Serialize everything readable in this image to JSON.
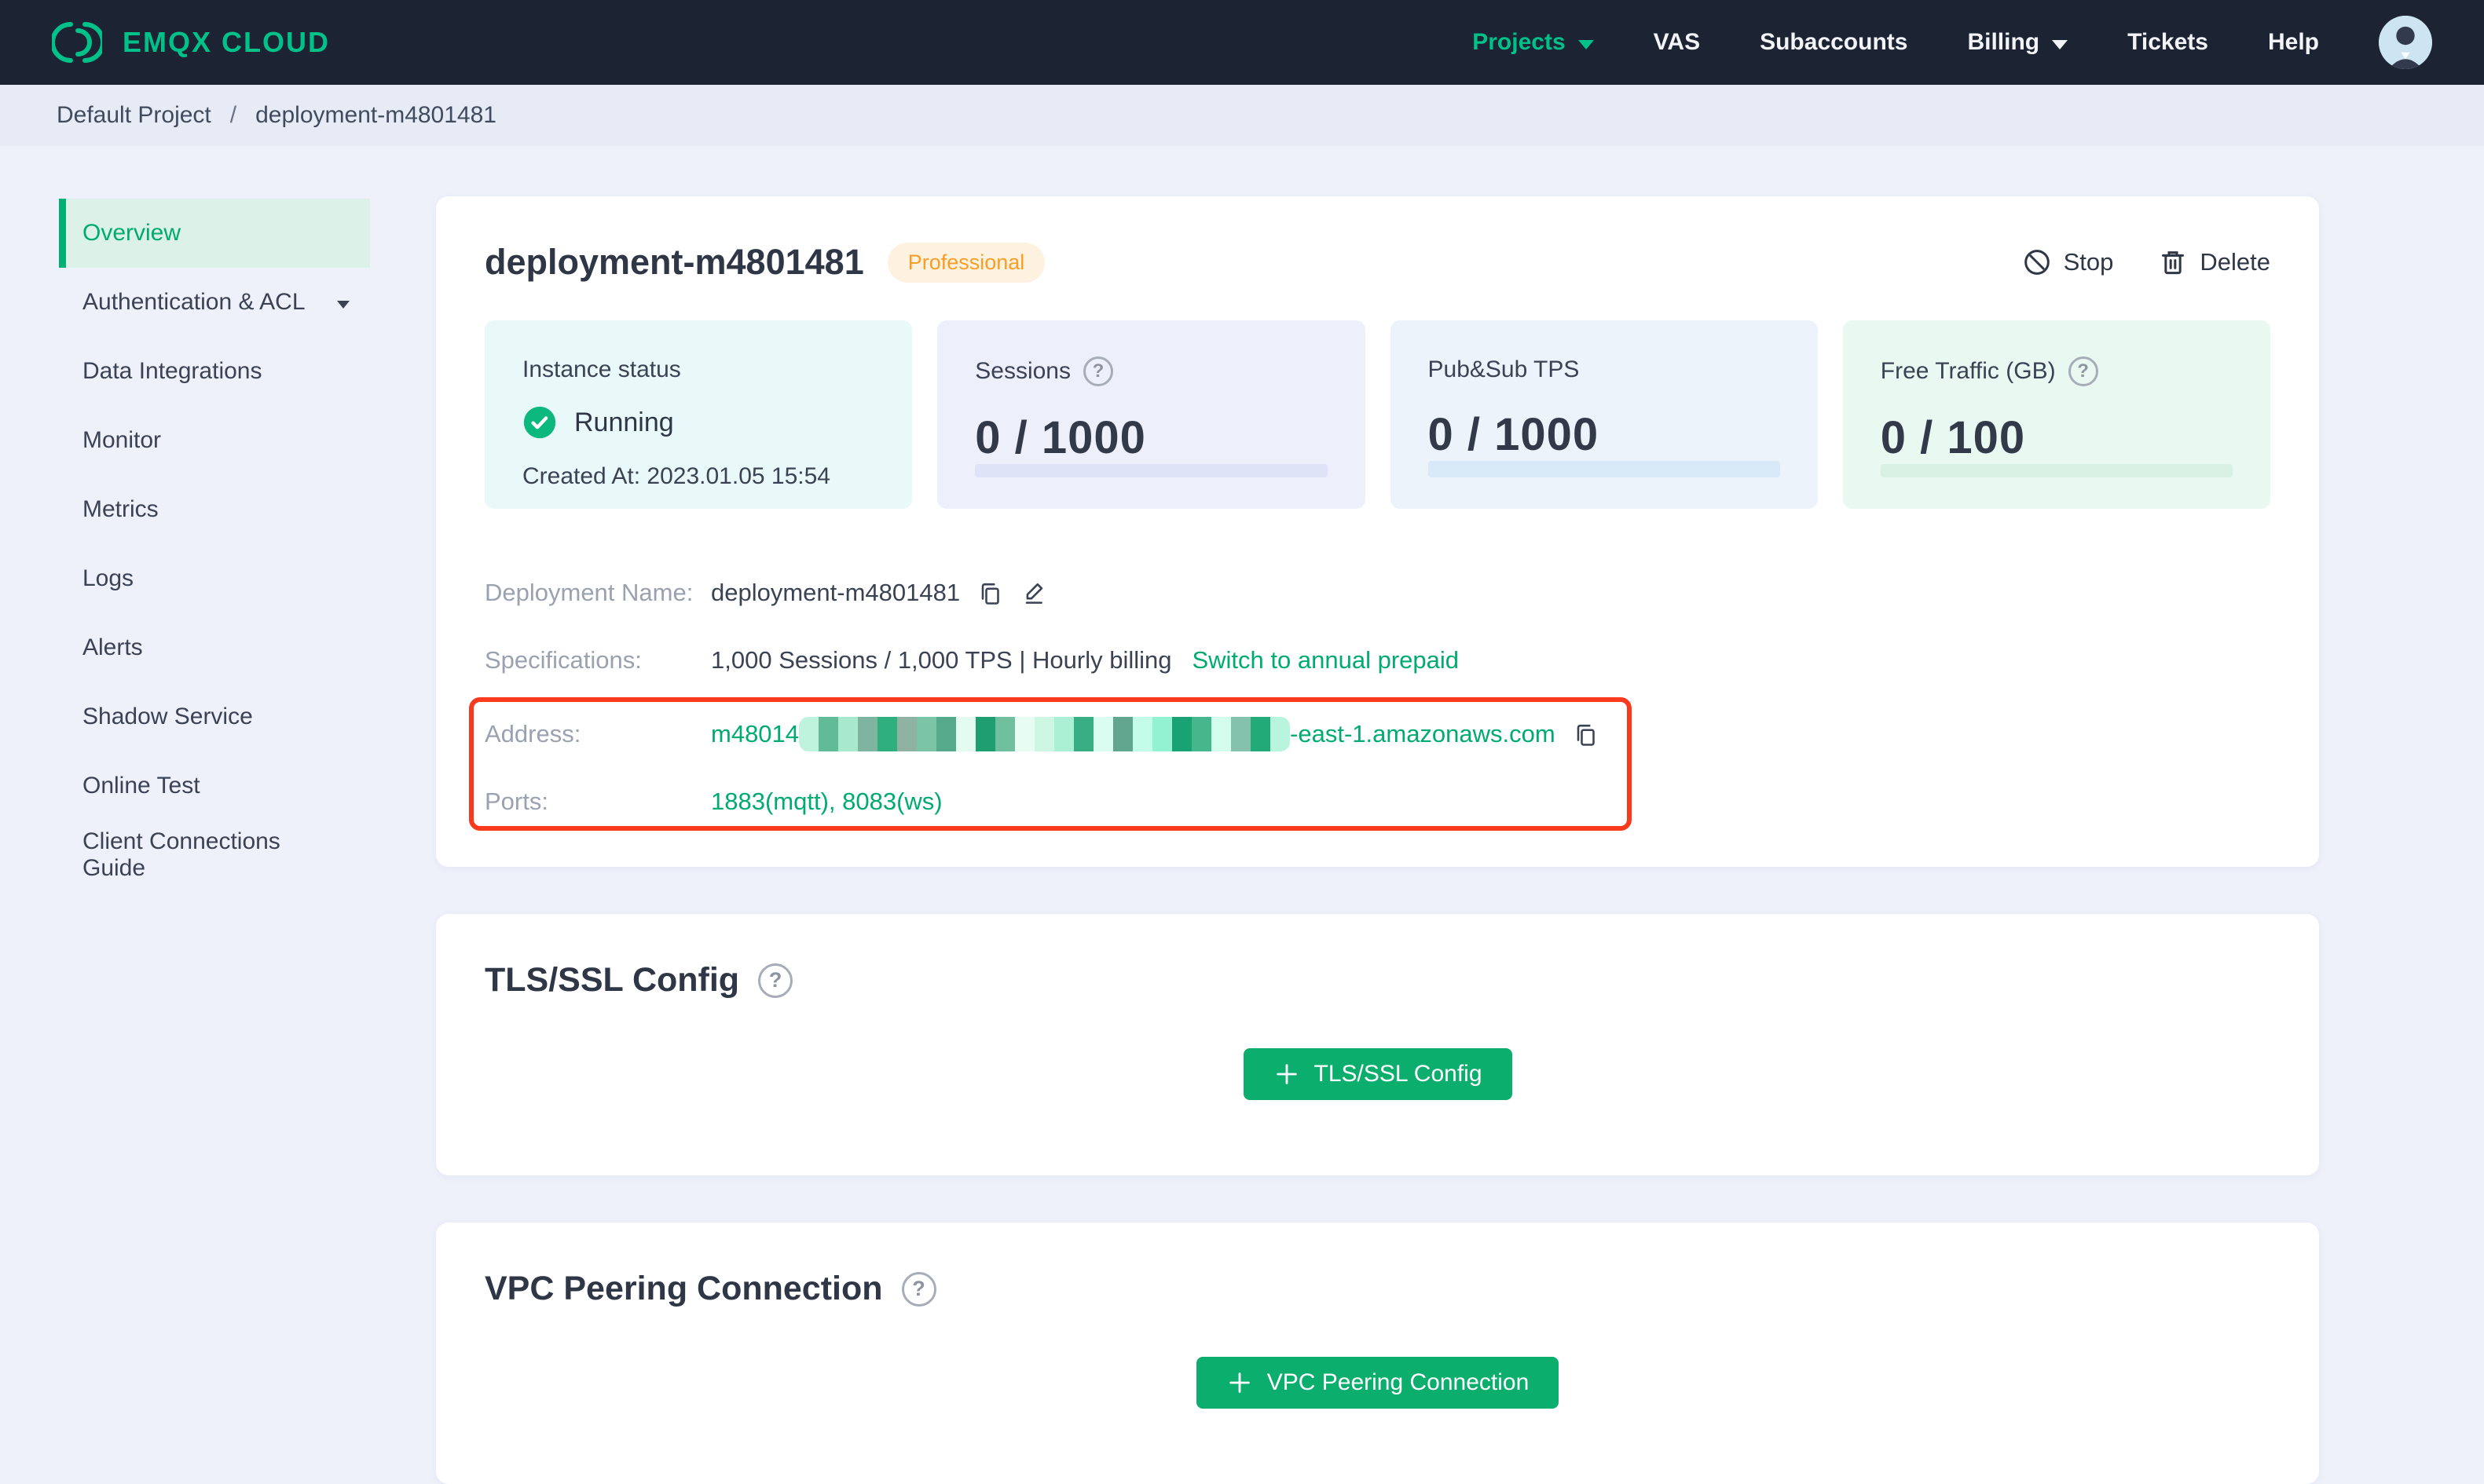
{
  "brand": {
    "name": "EMQX CLOUD",
    "color": "#00c18a"
  },
  "nav": {
    "items": [
      {
        "label": "Projects",
        "active": true,
        "caret": true
      },
      {
        "label": "VAS"
      },
      {
        "label": "Subaccounts"
      },
      {
        "label": "Billing",
        "caret": true
      },
      {
        "label": "Tickets"
      },
      {
        "label": "Help"
      }
    ]
  },
  "breadcrumb": {
    "project": "Default Project",
    "separator": "/",
    "current": "deployment-m4801481"
  },
  "sidebar": {
    "items": [
      {
        "label": "Overview",
        "active": true
      },
      {
        "label": "Authentication & ACL",
        "caret": true
      },
      {
        "label": "Data Integrations"
      },
      {
        "label": "Monitor"
      },
      {
        "label": "Metrics"
      },
      {
        "label": "Logs"
      },
      {
        "label": "Alerts"
      },
      {
        "label": "Shadow Service"
      },
      {
        "label": "Online Test"
      },
      {
        "label": "Client Connections Guide"
      }
    ]
  },
  "overview": {
    "title": "deployment-m4801481",
    "badge": "Professional",
    "stop_label": "Stop",
    "delete_label": "Delete",
    "instance": {
      "label": "Instance status",
      "status": "Running",
      "created": "Created At: 2023.01.05 15:54"
    },
    "stats": [
      {
        "label": "Sessions",
        "value": "0 / 1000",
        "help": true
      },
      {
        "label": "Pub&Sub TPS",
        "value": "0 / 1000",
        "help": false
      },
      {
        "label": "Free Traffic (GB)",
        "value": "0 / 100",
        "help": true
      }
    ],
    "details": {
      "name_label": "Deployment Name:",
      "name_value": "deployment-m4801481",
      "spec_label": "Specifications:",
      "spec_value": "1,000 Sessions / 1,000 TPS | Hourly billing",
      "spec_link": "Switch to annual prepaid",
      "address_label": "Address:",
      "address_prefix": "m48014",
      "address_suffix": "-east-1.amazonaws.com",
      "address_redacted_colors": [
        "#bff3dd",
        "#62bb97",
        "#a8e8cd",
        "#7fb5a0",
        "#2fae7e",
        "#8fb2a3",
        "#7cc4a6",
        "#57a98b",
        "#e4fbf1",
        "#1f9e72",
        "#70bf9f",
        "#e7fcf3",
        "#cdf6e3",
        "#abf0d5",
        "#39ae85",
        "#dbfcf0",
        "#63a68f",
        "#c4fcea",
        "#93f2d1",
        "#19a273",
        "#46b78d",
        "#d3fded",
        "#84c2ad",
        "#22aa78",
        "#b9f4de"
      ],
      "ports_label": "Ports:",
      "ports_value": "1883(mqtt), 8083(ws)"
    }
  },
  "tls": {
    "heading": "TLS/SSL Config",
    "button_label": "TLS/SSL Config"
  },
  "vpc": {
    "heading": "VPC Peering Connection",
    "button_label": "VPC Peering Connection"
  },
  "icons": {
    "help": "?"
  },
  "colors": {
    "nav_bg": "#1c2433",
    "accent_green": "#00b173",
    "active_sidebar_bg": "#dcf2e9",
    "badge_orange_text": "#f99d27",
    "badge_orange_bg": "#fdf2e0",
    "highlight_red": "#f93a1e",
    "button_green": "#0cae6d",
    "status_check_green": "#0db87e"
  }
}
